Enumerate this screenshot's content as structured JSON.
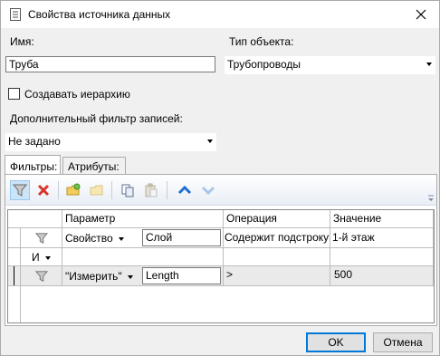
{
  "window": {
    "title": "Свойства источника данных",
    "close_glyph": "✕"
  },
  "form": {
    "name_label": "Имя:",
    "name_value": "Труба",
    "object_type_label": "Тип объекта:",
    "object_type_value": "Трубопроводы",
    "create_hierarchy_label": "Создавать иерархию",
    "create_hierarchy_checked": false,
    "extra_filter_label": "Дополнительный фильтр записей:",
    "extra_filter_value": "Не задано"
  },
  "tabs": [
    {
      "label": "Фильтры:",
      "active": true
    },
    {
      "label": "Атрибуты:",
      "active": false
    }
  ],
  "toolbar": {
    "buttons": [
      "filter-icon",
      "delete-icon",
      "add-folder-icon",
      "folder-icon",
      "copy-icon",
      "paste-icon",
      "move-up-icon",
      "move-down-icon"
    ]
  },
  "grid": {
    "columns": [
      "Параметр",
      "Операция",
      "Значение"
    ],
    "rows": [
      {
        "kind": "filter",
        "param_type": "Свойство",
        "param_name": "Слой",
        "operation": "Содержит подстроку",
        "value": "1-й этаж"
      },
      {
        "kind": "logic",
        "logic_op": "И"
      },
      {
        "kind": "filter",
        "param_type": "\"Измерить\"",
        "param_name": "Length",
        "operation": ">",
        "value": "500"
      }
    ]
  },
  "buttons": {
    "ok": "OK",
    "cancel": "Отмена"
  },
  "colors": {
    "accent": "#0078d7",
    "delete_red": "#d9342b",
    "arrow_blue": "#1e6fd0"
  }
}
